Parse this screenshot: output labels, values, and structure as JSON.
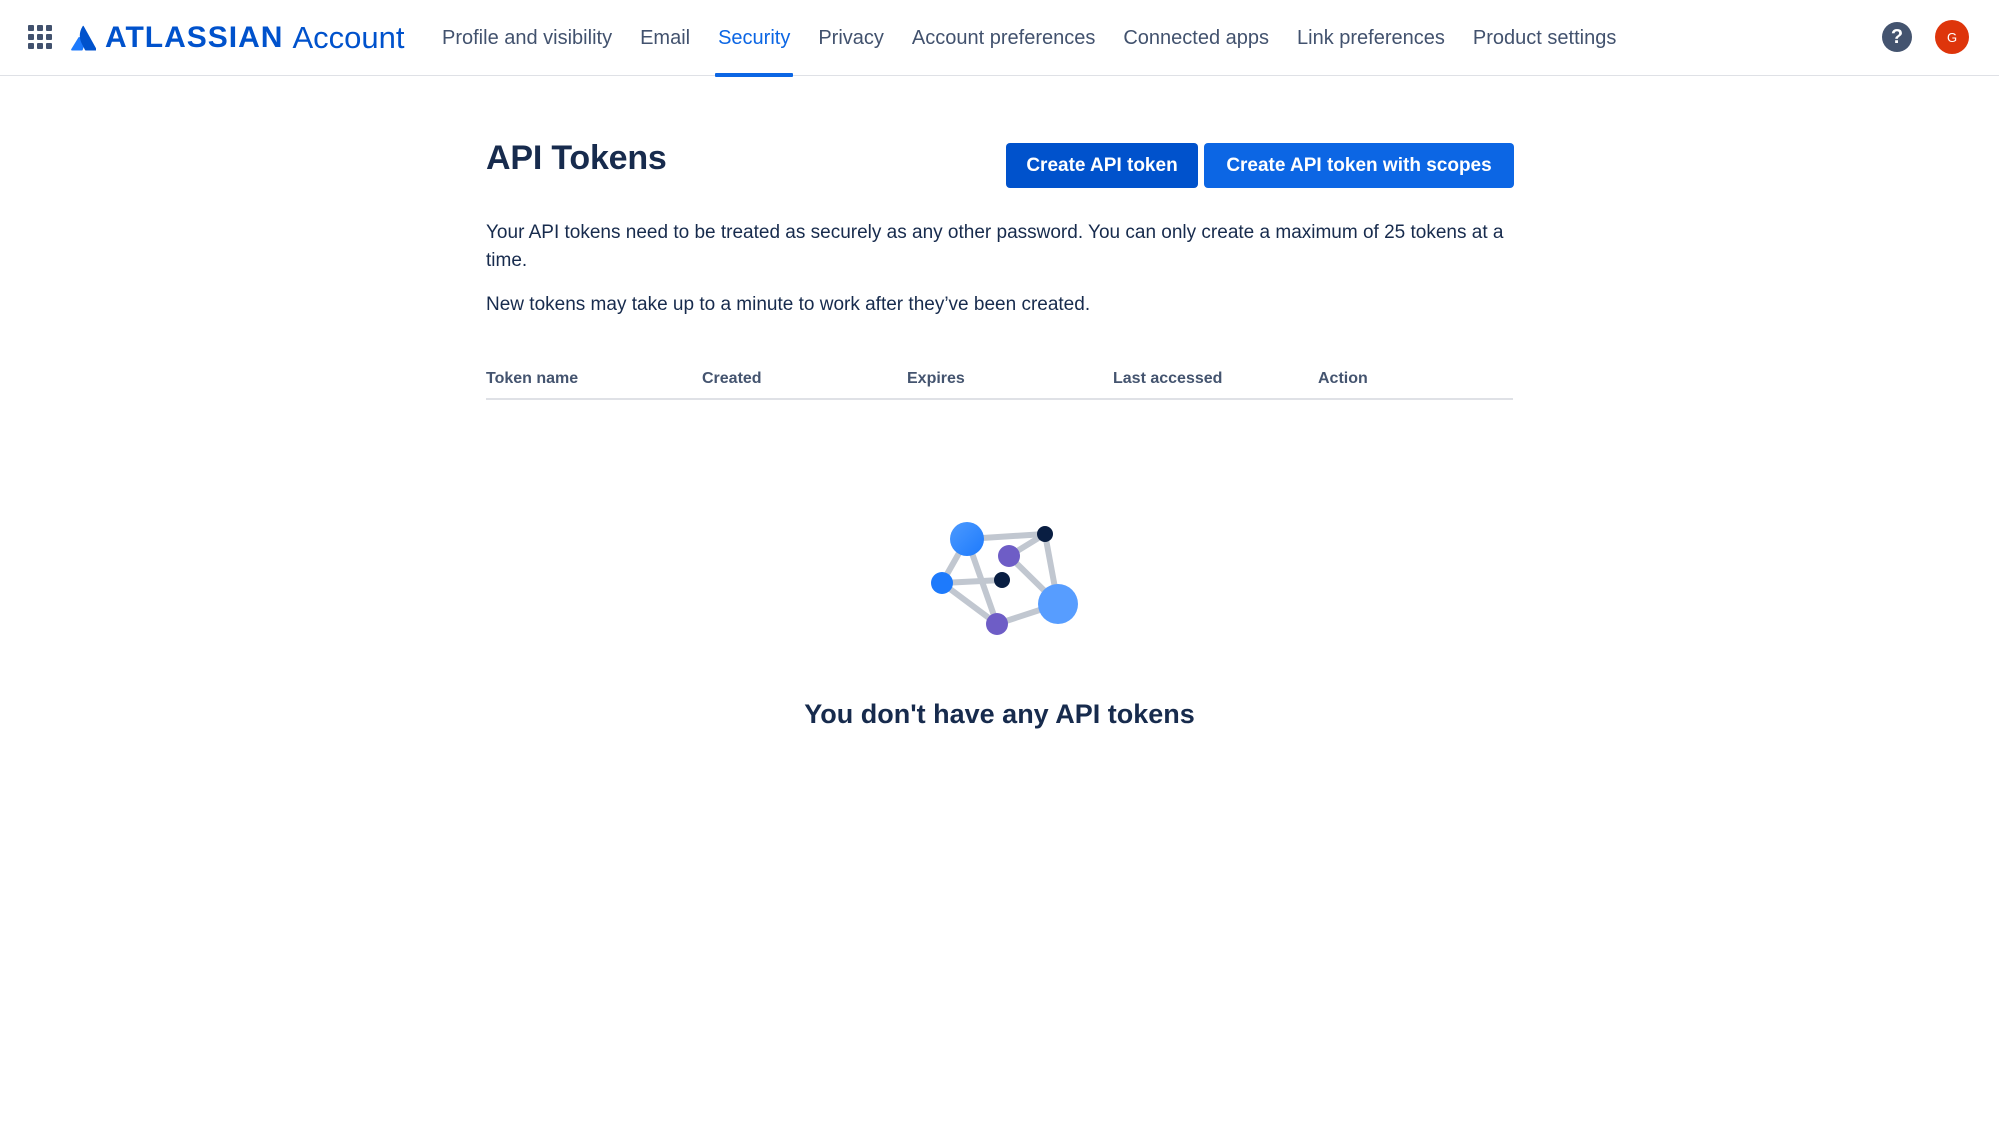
{
  "header": {
    "brand": "ATLASSIAN",
    "product": "Account",
    "nav": [
      {
        "label": "Profile and visibility",
        "active": false
      },
      {
        "label": "Email",
        "active": false
      },
      {
        "label": "Security",
        "active": true
      },
      {
        "label": "Privacy",
        "active": false
      },
      {
        "label": "Account preferences",
        "active": false
      },
      {
        "label": "Connected apps",
        "active": false
      },
      {
        "label": "Link preferences",
        "active": false
      },
      {
        "label": "Product settings",
        "active": false
      }
    ],
    "help_glyph": "?",
    "avatar_initial": "G"
  },
  "page": {
    "title": "API Tokens",
    "create_button": "Create API token",
    "create_scopes_button": "Create API token with scopes",
    "description": "Your API tokens need to be treated as securely as any other password. You can only create a maximum of 25 tokens at a time.",
    "note": "New tokens may take up to a minute to work after they’ve been created."
  },
  "table": {
    "columns": [
      "Token name",
      "Created",
      "Expires",
      "Last accessed",
      "Action"
    ]
  },
  "empty": {
    "title": "You don't have any API tokens"
  },
  "colors": {
    "brand_blue": "#0052cc",
    "active_blue": "#0c66e4",
    "text": "#172b4d",
    "subtle_text": "#44546f",
    "avatar": "#de350b"
  },
  "icons": {
    "app_switcher": "app-switcher-icon",
    "logo": "atlassian-logo-icon",
    "help": "help-icon",
    "empty": "token-network-illustration"
  }
}
